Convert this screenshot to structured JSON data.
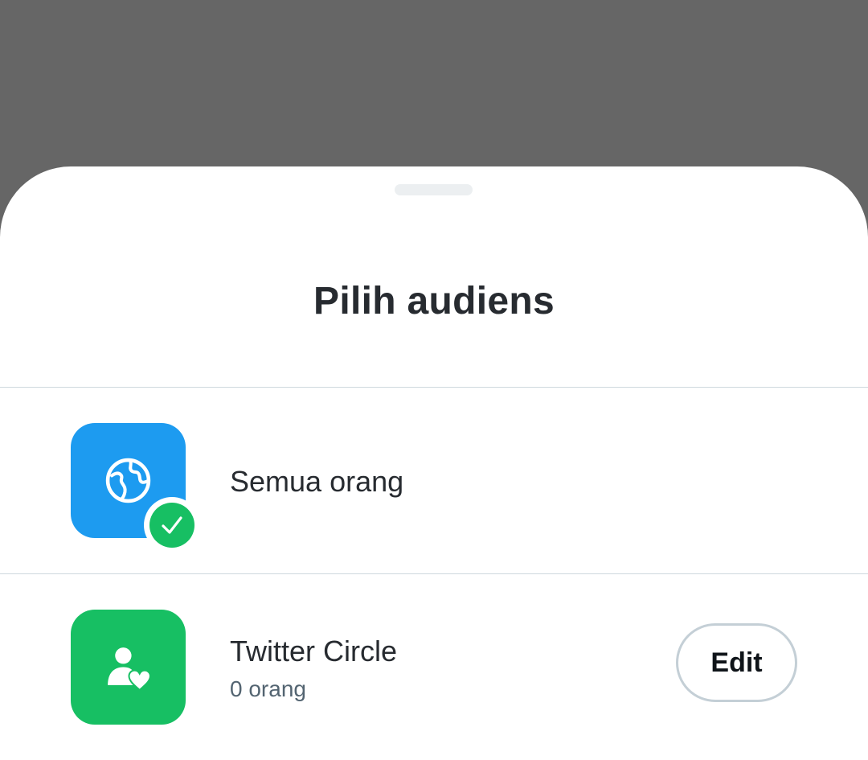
{
  "sheet": {
    "title": "Pilih audiens"
  },
  "options": [
    {
      "label": "Semua orang",
      "icon": "globe-icon",
      "icon_color": "#1d9bf0",
      "selected": true,
      "selected_icon": "checkmark-icon"
    },
    {
      "label": "Twitter Circle",
      "sublabel": "0 orang",
      "icon": "person-heart-icon",
      "icon_color": "#17bf63",
      "selected": false,
      "edit_label": "Edit"
    }
  ],
  "colors": {
    "overlay": "#666666",
    "accent_blue": "#1d9bf0",
    "accent_green": "#17bf63",
    "text_primary": "#272b30",
    "text_secondary": "#536471"
  }
}
